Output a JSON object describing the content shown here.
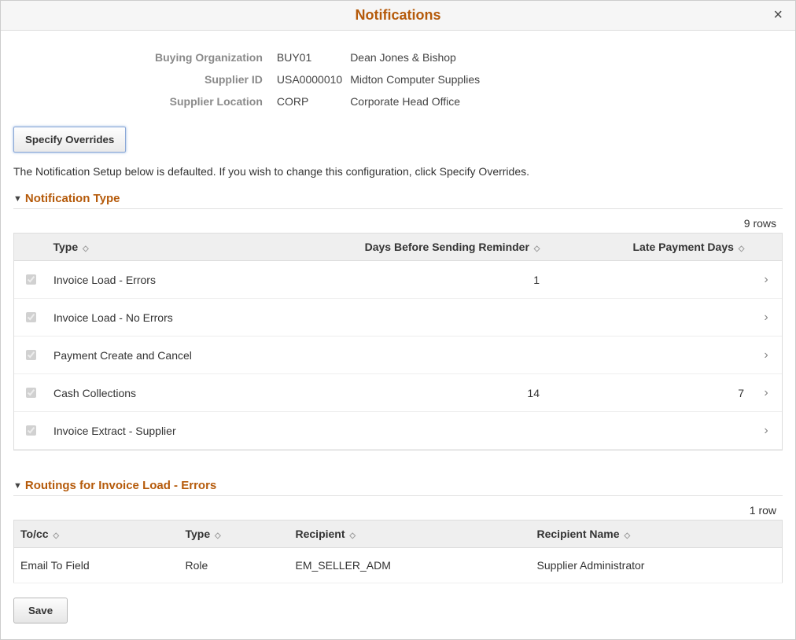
{
  "modal": {
    "title": "Notifications",
    "close": "×"
  },
  "info": {
    "buying_org_label": "Buying Organization",
    "buying_org_code": "BUY01",
    "buying_org_desc": "Dean Jones & Bishop",
    "supplier_id_label": "Supplier ID",
    "supplier_id_code": "USA0000010",
    "supplier_id_desc": "Midton Computer Supplies",
    "supplier_loc_label": "Supplier Location",
    "supplier_loc_code": "CORP",
    "supplier_loc_desc": "Corporate Head Office"
  },
  "buttons": {
    "specify_overrides": "Specify Overrides",
    "save": "Save"
  },
  "helper_text": "The Notification Setup below is defaulted. If you wish to change this configuration, click Specify Overrides.",
  "notif_section": {
    "title": "Notification Type",
    "row_count": "9 rows",
    "headers": {
      "type": "Type",
      "days": "Days Before Sending Reminder",
      "late": "Late Payment Days"
    },
    "rows": [
      {
        "checked": true,
        "type": "Invoice Load - Errors",
        "days": "1",
        "late": ""
      },
      {
        "checked": true,
        "type": "Invoice Load - No Errors",
        "days": "",
        "late": ""
      },
      {
        "checked": true,
        "type": "Payment Create and Cancel",
        "days": "",
        "late": ""
      },
      {
        "checked": true,
        "type": "Cash Collections",
        "days": "14",
        "late": "7"
      },
      {
        "checked": true,
        "type": "Invoice Extract - Supplier",
        "days": "",
        "late": ""
      }
    ]
  },
  "routings_section": {
    "title": "Routings for Invoice Load - Errors",
    "row_count": "1 row",
    "headers": {
      "tocc": "To/cc",
      "type": "Type",
      "recipient": "Recipient",
      "recipient_name": "Recipient Name"
    },
    "rows": [
      {
        "tocc": "Email To Field",
        "type": "Role",
        "recipient": "EM_SELLER_ADM",
        "recipient_name": "Supplier Administrator"
      }
    ]
  }
}
